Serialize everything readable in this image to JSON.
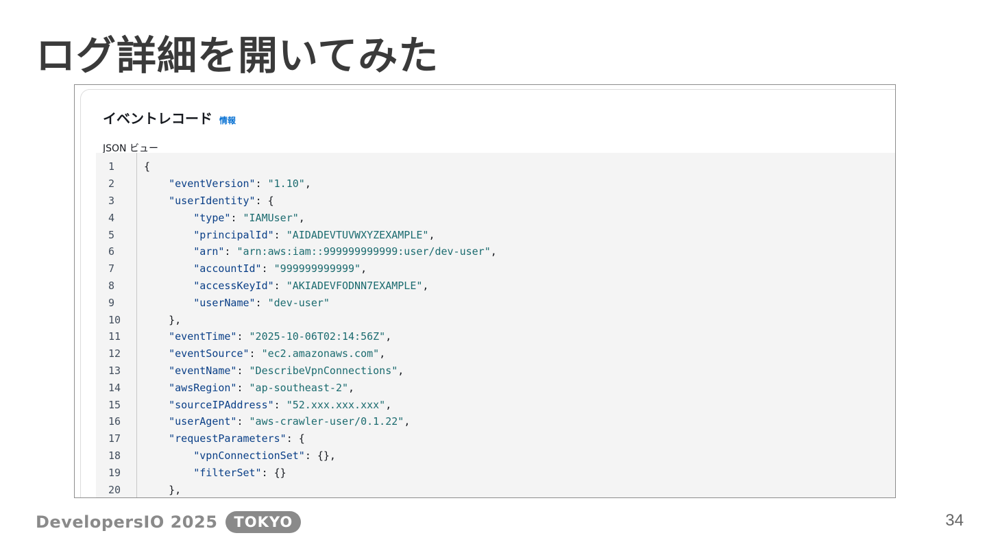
{
  "slide": {
    "title": "ログ詳細を開いてみた",
    "page_number": "34"
  },
  "panel": {
    "title": "イベントレコード",
    "info_link": "情報",
    "view_label": "JSON ビュー"
  },
  "code_lines": [
    {
      "no": "1",
      "tokens": [
        {
          "t": "p",
          "v": "{"
        }
      ]
    },
    {
      "no": "2",
      "tokens": [
        {
          "t": "p",
          "v": "    "
        },
        {
          "t": "k",
          "v": "\"eventVersion\""
        },
        {
          "t": "p",
          "v": ": "
        },
        {
          "t": "s",
          "v": "\"1.10\""
        },
        {
          "t": "p",
          "v": ","
        }
      ]
    },
    {
      "no": "3",
      "tokens": [
        {
          "t": "p",
          "v": "    "
        },
        {
          "t": "k",
          "v": "\"userIdentity\""
        },
        {
          "t": "p",
          "v": ": {"
        }
      ]
    },
    {
      "no": "4",
      "tokens": [
        {
          "t": "p",
          "v": "        "
        },
        {
          "t": "k",
          "v": "\"type\""
        },
        {
          "t": "p",
          "v": ": "
        },
        {
          "t": "s",
          "v": "\"IAMUser\""
        },
        {
          "t": "p",
          "v": ","
        }
      ]
    },
    {
      "no": "5",
      "tokens": [
        {
          "t": "p",
          "v": "        "
        },
        {
          "t": "k",
          "v": "\"principalId\""
        },
        {
          "t": "p",
          "v": ": "
        },
        {
          "t": "s",
          "v": "\"AIDADEVTUVWXYZEXAMPLE\""
        },
        {
          "t": "p",
          "v": ","
        }
      ]
    },
    {
      "no": "6",
      "tokens": [
        {
          "t": "p",
          "v": "        "
        },
        {
          "t": "k",
          "v": "\"arn\""
        },
        {
          "t": "p",
          "v": ": "
        },
        {
          "t": "s",
          "v": "\"arn:aws:iam::999999999999:user/dev-user\""
        },
        {
          "t": "p",
          "v": ","
        }
      ]
    },
    {
      "no": "7",
      "tokens": [
        {
          "t": "p",
          "v": "        "
        },
        {
          "t": "k",
          "v": "\"accountId\""
        },
        {
          "t": "p",
          "v": ": "
        },
        {
          "t": "s",
          "v": "\"999999999999\""
        },
        {
          "t": "p",
          "v": ","
        }
      ]
    },
    {
      "no": "8",
      "tokens": [
        {
          "t": "p",
          "v": "        "
        },
        {
          "t": "k",
          "v": "\"accessKeyId\""
        },
        {
          "t": "p",
          "v": ": "
        },
        {
          "t": "s",
          "v": "\"AKIADEVFODNN7EXAMPLE\""
        },
        {
          "t": "p",
          "v": ","
        }
      ]
    },
    {
      "no": "9",
      "tokens": [
        {
          "t": "p",
          "v": "        "
        },
        {
          "t": "k",
          "v": "\"userName\""
        },
        {
          "t": "p",
          "v": ": "
        },
        {
          "t": "s",
          "v": "\"dev-user\""
        }
      ]
    },
    {
      "no": "10",
      "tokens": [
        {
          "t": "p",
          "v": "    },"
        }
      ]
    },
    {
      "no": "11",
      "tokens": [
        {
          "t": "p",
          "v": "    "
        },
        {
          "t": "k",
          "v": "\"eventTime\""
        },
        {
          "t": "p",
          "v": ": "
        },
        {
          "t": "s",
          "v": "\"2025-10-06T02:14:56Z\""
        },
        {
          "t": "p",
          "v": ","
        }
      ]
    },
    {
      "no": "12",
      "tokens": [
        {
          "t": "p",
          "v": "    "
        },
        {
          "t": "k",
          "v": "\"eventSource\""
        },
        {
          "t": "p",
          "v": ": "
        },
        {
          "t": "s",
          "v": "\"ec2.amazonaws.com\""
        },
        {
          "t": "p",
          "v": ","
        }
      ]
    },
    {
      "no": "13",
      "tokens": [
        {
          "t": "p",
          "v": "    "
        },
        {
          "t": "k",
          "v": "\"eventName\""
        },
        {
          "t": "p",
          "v": ": "
        },
        {
          "t": "s",
          "v": "\"DescribeVpnConnections\""
        },
        {
          "t": "p",
          "v": ","
        }
      ]
    },
    {
      "no": "14",
      "tokens": [
        {
          "t": "p",
          "v": "    "
        },
        {
          "t": "k",
          "v": "\"awsRegion\""
        },
        {
          "t": "p",
          "v": ": "
        },
        {
          "t": "s",
          "v": "\"ap-southeast-2\""
        },
        {
          "t": "p",
          "v": ","
        }
      ]
    },
    {
      "no": "15",
      "tokens": [
        {
          "t": "p",
          "v": "    "
        },
        {
          "t": "k",
          "v": "\"sourceIPAddress\""
        },
        {
          "t": "p",
          "v": ": "
        },
        {
          "t": "s",
          "v": "\"52.xxx.xxx.xxx\""
        },
        {
          "t": "p",
          "v": ","
        }
      ]
    },
    {
      "no": "16",
      "tokens": [
        {
          "t": "p",
          "v": "    "
        },
        {
          "t": "k",
          "v": "\"userAgent\""
        },
        {
          "t": "p",
          "v": ": "
        },
        {
          "t": "s",
          "v": "\"aws-crawler-user/0.1.22\""
        },
        {
          "t": "p",
          "v": ","
        }
      ]
    },
    {
      "no": "17",
      "tokens": [
        {
          "t": "p",
          "v": "    "
        },
        {
          "t": "k",
          "v": "\"requestParameters\""
        },
        {
          "t": "p",
          "v": ": {"
        }
      ]
    },
    {
      "no": "18",
      "tokens": [
        {
          "t": "p",
          "v": "        "
        },
        {
          "t": "k",
          "v": "\"vpnConnectionSet\""
        },
        {
          "t": "p",
          "v": ": {},"
        }
      ]
    },
    {
      "no": "19",
      "tokens": [
        {
          "t": "p",
          "v": "        "
        },
        {
          "t": "k",
          "v": "\"filterSet\""
        },
        {
          "t": "p",
          "v": ": {}"
        }
      ]
    },
    {
      "no": "20",
      "tokens": [
        {
          "t": "p",
          "v": "    },"
        }
      ]
    }
  ],
  "footer": {
    "brand": "DevelopersIO 2025",
    "badge": "TOKYO"
  },
  "colors": {
    "json_key": "#0a3f87",
    "json_string": "#1b6b6f",
    "link": "#0972d3"
  }
}
